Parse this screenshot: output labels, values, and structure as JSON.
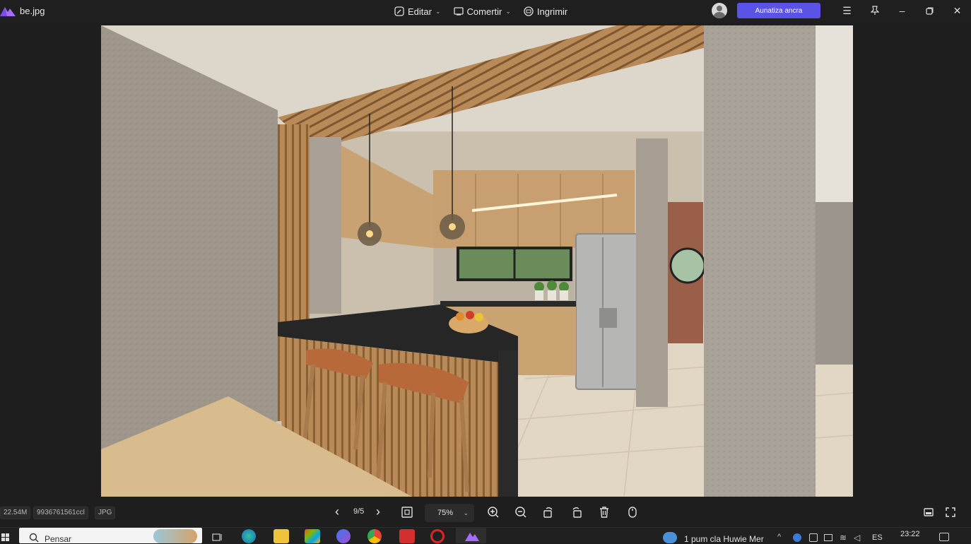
{
  "titlebar": {
    "file_name": "be.jpg",
    "edit_label": "Editar",
    "convert_label": "Comertir",
    "print_label": "Ingrimir",
    "upgrade_label": "Aunatiza ancra"
  },
  "bottombar": {
    "file_size": "22.54M",
    "dimensions": "9936761561ccl",
    "file_type": "JPG",
    "page_indicator": "9/5",
    "zoom": "75%"
  },
  "taskbar": {
    "search_placeholder": "Pensar",
    "weather_text": "1 pum cla Huwie Mer",
    "lang": "ES",
    "clock": "23:22"
  },
  "colors": {
    "accent": "#5b53e6",
    "background": "#1e1e1e"
  }
}
